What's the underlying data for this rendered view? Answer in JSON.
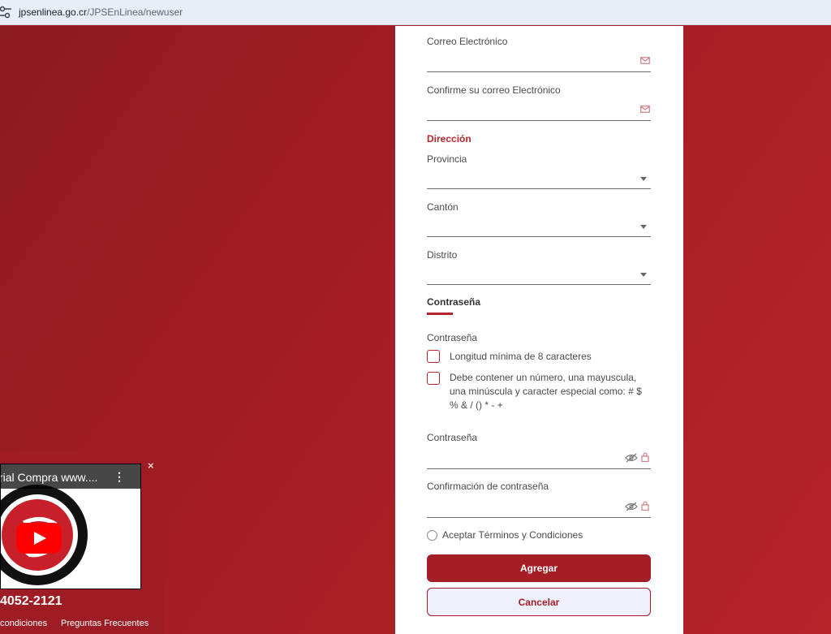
{
  "browser": {
    "url_host": "jpsenlinea.go.cr",
    "url_path": "/JPSEnLinea/newuser"
  },
  "form": {
    "email_label": "Correo Electrónico",
    "email_confirm_label": "Confirme su correo Electrónico",
    "address_heading": "Dirección",
    "province_label": "Provincia",
    "canton_label": "Cantón",
    "district_label": "Distrito",
    "password_tab": "Contraseña",
    "password_requirements_label": "Contraseña",
    "requirements": [
      "Longitud mínima de 8 caracteres",
      "Debe contener un número, una mayuscula, una minúscula y caracter especial como: # $ % & / () * - +"
    ],
    "password_label": "Contraseña",
    "password_confirm_label": "Confirmación de contraseña",
    "terms_label": "Aceptar Términos y Condiciones",
    "add_button": "Agregar",
    "cancel_button": "Cancelar"
  },
  "popup": {
    "video_title": "rial Compra www....",
    "phone": "4052-2121",
    "footer_links": [
      "condiciones",
      "Preguntas Frecuentes"
    ],
    "close_label": "×"
  },
  "colors": {
    "brand_red": "#a51d25",
    "accent_red": "#b5262c"
  }
}
